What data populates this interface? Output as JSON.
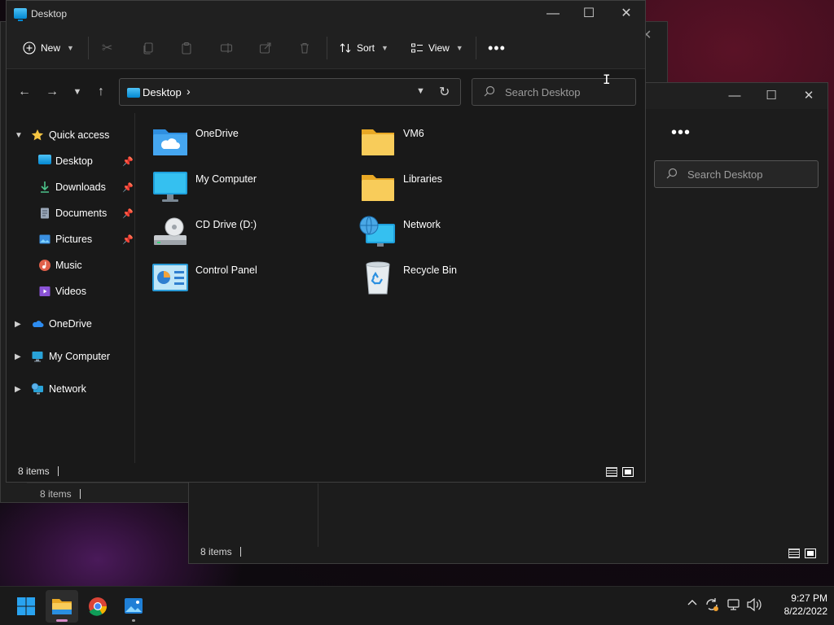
{
  "back_window_1": {
    "status_items": "8 items"
  },
  "back_window_2": {
    "search_placeholder": "Search Desktop",
    "status_items": "8 items"
  },
  "window": {
    "title": "Desktop",
    "toolbar": {
      "new_label": "New",
      "sort_label": "Sort",
      "view_label": "View"
    },
    "address": {
      "location": "Desktop"
    },
    "search": {
      "placeholder": "Search Desktop"
    },
    "sidebar": {
      "quick_access": "Quick access",
      "items": [
        {
          "label": "Desktop",
          "icon": "desktop-icon",
          "pinned": true
        },
        {
          "label": "Downloads",
          "icon": "downloads-icon",
          "pinned": true
        },
        {
          "label": "Documents",
          "icon": "documents-icon",
          "pinned": true
        },
        {
          "label": "Pictures",
          "icon": "pictures-icon",
          "pinned": true
        },
        {
          "label": "Music",
          "icon": "music-icon",
          "pinned": false
        },
        {
          "label": "Videos",
          "icon": "videos-icon",
          "pinned": false
        }
      ],
      "roots": [
        {
          "label": "OneDrive",
          "icon": "onedrive-icon"
        },
        {
          "label": "My Computer",
          "icon": "computer-icon"
        },
        {
          "label": "Network",
          "icon": "network-icon"
        }
      ]
    },
    "files": [
      {
        "name": "OneDrive",
        "icon": "onedrive-folder-icon"
      },
      {
        "name": "VM6",
        "icon": "folder-icon"
      },
      {
        "name": "My Computer",
        "icon": "computer-icon"
      },
      {
        "name": "Libraries",
        "icon": "folder-icon"
      },
      {
        "name": "CD Drive (D:)",
        "icon": "cd-drive-icon"
      },
      {
        "name": "Network",
        "icon": "network-icon"
      },
      {
        "name": "Control Panel",
        "icon": "control-panel-icon"
      },
      {
        "name": "Recycle Bin",
        "icon": "recycle-bin-icon"
      }
    ],
    "status": {
      "items": "8 items"
    }
  },
  "taskbar": {
    "apps": [
      {
        "name": "start",
        "icon": "windows-start-icon"
      },
      {
        "name": "file-explorer",
        "icon": "file-explorer-icon",
        "active": true
      },
      {
        "name": "chrome",
        "icon": "chrome-icon"
      },
      {
        "name": "photos",
        "icon": "photos-icon"
      }
    ],
    "clock": {
      "time": "9:27 PM",
      "date": "8/22/2022"
    }
  },
  "colors": {
    "accent": "#0a84ff",
    "folder_yellow": "#f5c542",
    "window_bg": "#191919",
    "taskbar_bg": "#1a1a1a"
  }
}
